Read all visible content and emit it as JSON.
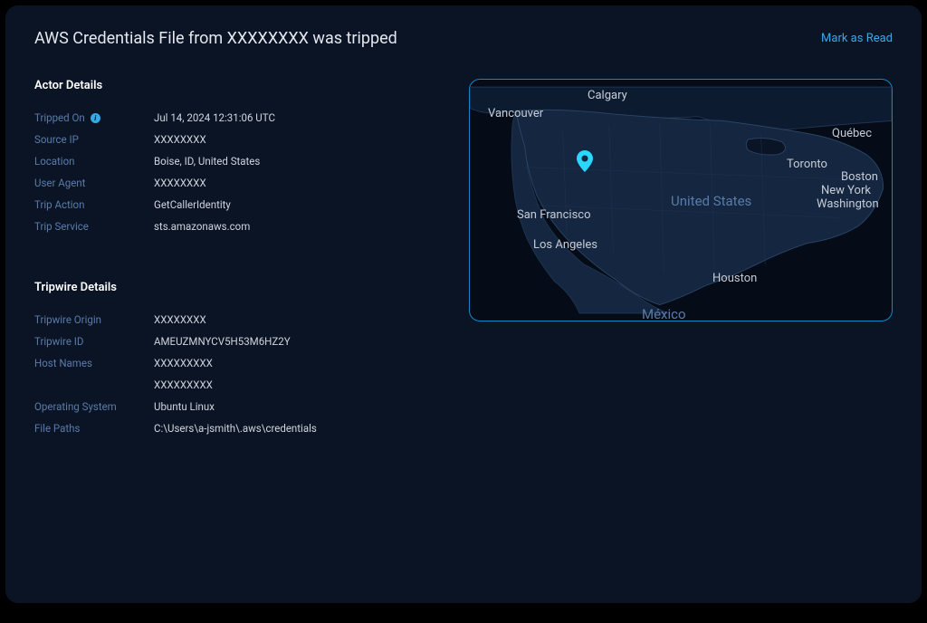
{
  "header": {
    "title": "AWS Credentials File from XXXXXXXX was tripped",
    "mark_read": "Mark as Read"
  },
  "actor": {
    "section_title": "Actor Details",
    "tripped_on_label": "Tripped On",
    "tripped_on_value": "Jul 14, 2024 12:31:06 UTC",
    "source_ip_label": "Source IP",
    "source_ip_value": "XXXXXXXX",
    "location_label": "Location",
    "location_value": "Boise, ID,  United States",
    "user_agent_label": "User Agent",
    "user_agent_value": "XXXXXXXX",
    "trip_action_label": "Trip Action",
    "trip_action_value": "GetCallerIdentity",
    "trip_service_label": "Trip Service",
    "trip_service_value": "sts.amazonaws.com"
  },
  "tripwire": {
    "section_title": "Tripwire Details",
    "origin_label": "Tripwire Origin",
    "origin_value": "XXXXXXXX",
    "id_label": "Tripwire ID",
    "id_value": "AMEUZMNYCV5H53M6HZ2Y",
    "host_names_label": "Host Names",
    "host_names_value1": "XXXXXXXXX",
    "host_names_value2": "XXXXXXXXX",
    "os_label": "Operating System",
    "os_value": "Ubuntu Linux",
    "file_paths_label": "File Paths",
    "file_paths_value": "C:\\Users\\a-jsmith\\.aws\\credentials"
  },
  "map": {
    "labels": {
      "calgary": "Calgary",
      "vancouver": "Vancouver",
      "quebec": "Québec",
      "toronto": "Toronto",
      "boston": "Boston",
      "newyork": "New York",
      "washington": "Washington",
      "sanfrancisco": "San Francisco",
      "losangeles": "Los Angeles",
      "houston": "Houston",
      "unitedstates": "United States",
      "mexico": "México"
    }
  }
}
